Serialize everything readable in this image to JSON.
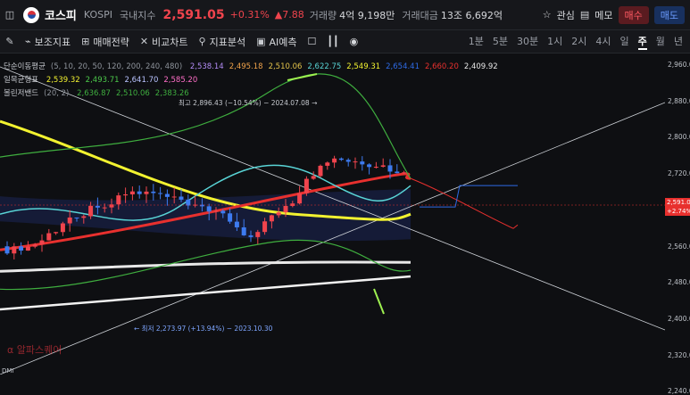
{
  "header": {
    "name": "코스피",
    "code": "KOSPI",
    "market": "국내지수",
    "price": "2,591.05",
    "change_pct": "+0.31%",
    "change_abs": "▲7.88",
    "volume_label": "거래량",
    "volume": "4억 9,198만",
    "amount_label": "거래대금",
    "amount": "13조 6,692억",
    "favorite": "관심",
    "memo": "메모",
    "buy": "매수",
    "sell": "매도"
  },
  "toolbar": {
    "indicators": "보조지표",
    "strategy": "매매전략",
    "compare": "비교차트",
    "analysis": "지표분석",
    "ai": "AI예측",
    "periods": [
      "1분",
      "5분",
      "30분",
      "1시",
      "2시",
      "4시",
      "일",
      "주",
      "월",
      "년"
    ],
    "active_period": "주"
  },
  "legend": {
    "ma": {
      "label": "단순이동평균",
      "params": "(5, 10, 20, 50, 120, 200, 240, 480)",
      "values": [
        "2,538.14",
        "2,495.18",
        "2,510.06",
        "2,622.75",
        "2,549.31",
        "2,654.41",
        "2,660.20",
        "2,409.92"
      ],
      "colors": [
        "#b38cf5",
        "#f0a24a",
        "#e3c34a",
        "#59d4d6",
        "#f2f230",
        "#2e6be6",
        "#e8302e",
        "#e8e8e8"
      ]
    },
    "ichimoku": {
      "label": "일목균형표",
      "values": [
        "2,539.32",
        "2,493.71",
        "2,641.70",
        "2,585.20"
      ],
      "colors": [
        "#f2f230",
        "#4cc94a",
        "#b9c3ff",
        "#ff6ec7"
      ]
    },
    "bollinger": {
      "label": "볼린저밴드",
      "params": "(20, 2)",
      "values": [
        "2,636.87",
        "2,510.06",
        "2,383.26"
      ],
      "colors": [
        "#3fae3f",
        "#3fae3f",
        "#3fae3f"
      ]
    }
  },
  "annotations": {
    "high": "최고 2,896.43 (−10.54%) − 2024.07.08 →",
    "low": "← 최저 2,273.97 (+13.94%) − 2023.10.30"
  },
  "yaxis": [
    "2,960.00",
    "2,880.00",
    "2,800.00",
    "2,720.00",
    "2,640.00",
    "2,560.00",
    "2,480.00",
    "2,400.00",
    "2,320.00",
    "2,240.00"
  ],
  "price_tags": {
    "current": "2,591.0",
    "pct": "+2.74%"
  },
  "watermark": "알파스퀘어",
  "bottom_label": "DMI"
}
